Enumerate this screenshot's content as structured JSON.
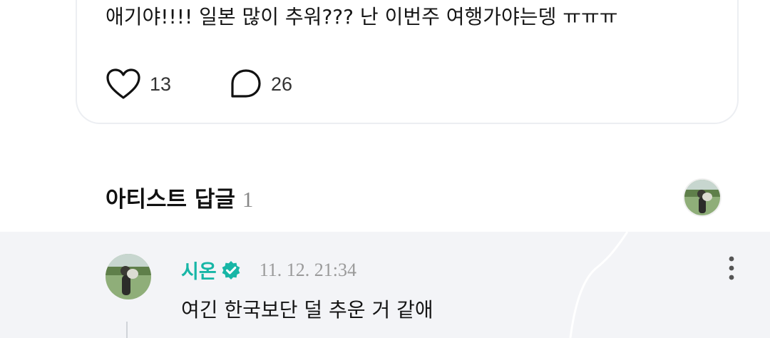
{
  "post": {
    "text": "애기야!!!! 일본 많이 추워??? 난 이번주 여행가야는뎅 ㅠㅠㅠ",
    "like_count": "13",
    "comment_count": "26"
  },
  "artist_replies": {
    "title": "아티스트 답글",
    "count": "1"
  },
  "reply": {
    "name": "시온",
    "time": "11. 12. 21:34",
    "text": "여긴 한국보단 덜 추운 거 같애"
  },
  "colors": {
    "accent": "#17b6a6",
    "reply_background": "#f3f4f7",
    "muted_text": "#9a9a9a"
  },
  "icons": {
    "like": "heart-outline-icon",
    "comment": "speech-bubble-icon",
    "verified": "verified-badge-icon",
    "more": "more-vertical-icon"
  }
}
